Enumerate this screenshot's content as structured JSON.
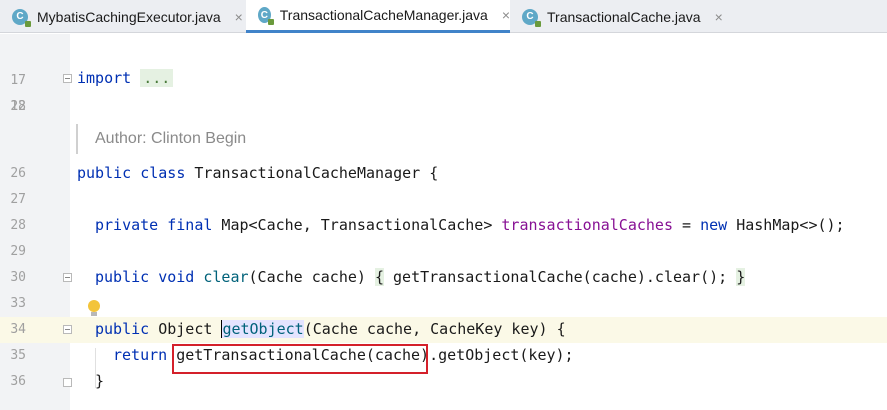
{
  "tabs": [
    {
      "label": "MybatisCachingExecutor.java",
      "close": "×",
      "icon": "C"
    },
    {
      "label": "TransactionalCacheManager.java",
      "close": "×",
      "icon": "C"
    },
    {
      "label": "TransactionalCache.java",
      "close": "×",
      "icon": "C"
    }
  ],
  "active_tab": 1,
  "line_numbers": {
    "l17": "17",
    "l18": "18",
    "l22": "22",
    "l26": "26",
    "l27": "27",
    "l28": "28",
    "l29": "29",
    "l30": "30",
    "l33": "33",
    "l34": "34",
    "l35": "35",
    "l36": "36"
  },
  "code": {
    "import_kw": "import",
    "import_dots": "...",
    "author": "Author: Clinton Begin",
    "l26_kw": "public class",
    "l26_rest": " TransactionalCacheManager {",
    "l28_kw": "private final",
    "l28_type": " Map<Cache, TransactionalCache> ",
    "l28_field": "transactionalCaches",
    "l28_eq": " = ",
    "l28_new": "new",
    "l28_end": " HashMap<>();",
    "l30_kw": "public void",
    "l30_sp": " ",
    "l30_method": "clear",
    "l30_params": "(Cache cache) ",
    "l30_open": "{",
    "l30_body": " getTransactionalCache(cache).clear(); ",
    "l30_close": "}",
    "l34_kw": "public",
    "l34_type": " Object ",
    "l34_method": "getObject",
    "l34_rest": "(Cache cache, CacheKey key) {",
    "l35_kw": "return",
    "l35_sp": " ",
    "l35_call": "getTransactionalCache(cache)",
    "l35_rest": ".getObject(key);",
    "l36": "}"
  }
}
